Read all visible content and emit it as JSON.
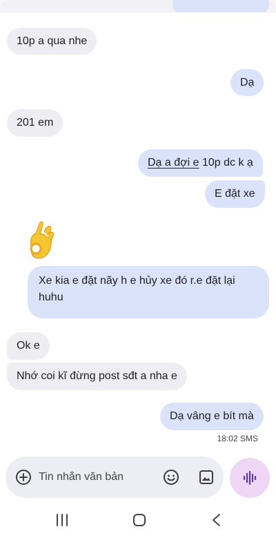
{
  "messages": [
    {
      "id": "m1",
      "direction": "incoming",
      "text": "10p a qua nhe"
    },
    {
      "id": "m2",
      "direction": "outgoing",
      "text": "Dạ"
    },
    {
      "id": "m3",
      "direction": "incoming",
      "text": "201 em"
    },
    {
      "id": "m4",
      "direction": "outgoing",
      "text_link": "Dạ a đợi e",
      "text_rest": " 10p dc k ạ"
    },
    {
      "id": "m5",
      "direction": "outgoing",
      "text": "E đặt xe"
    },
    {
      "id": "m6",
      "direction": "incoming",
      "emoji": "ok-hand-icon"
    },
    {
      "id": "m7",
      "direction": "outgoing",
      "text": "Xe kia e đặt nãy h e hủy xe đó r.e đặt lại huhu"
    },
    {
      "id": "m8",
      "direction": "incoming",
      "text": "Ok e"
    },
    {
      "id": "m9",
      "direction": "incoming",
      "text": "Nhớ coi kĩ đừng post sđt a nha e"
    },
    {
      "id": "m10",
      "direction": "outgoing",
      "text": "Dạ vâng e bít mà"
    }
  ],
  "last_timestamp": "18:02 SMS",
  "composer": {
    "placeholder": "Tin nhắn văn bản",
    "value": "",
    "icons": [
      "add-icon",
      "emoji-icon",
      "gallery-icon"
    ]
  },
  "voice_button": {
    "icon": "voice-waveform-icon"
  },
  "navigation": [
    "recent-apps-icon",
    "home-icon",
    "back-icon"
  ],
  "colors": {
    "incoming_bubble": "#eeeef2",
    "outgoing_bubble": "#dbe3fb",
    "voice_button": "#f0d6f6",
    "accent": "#5b3a9e"
  }
}
